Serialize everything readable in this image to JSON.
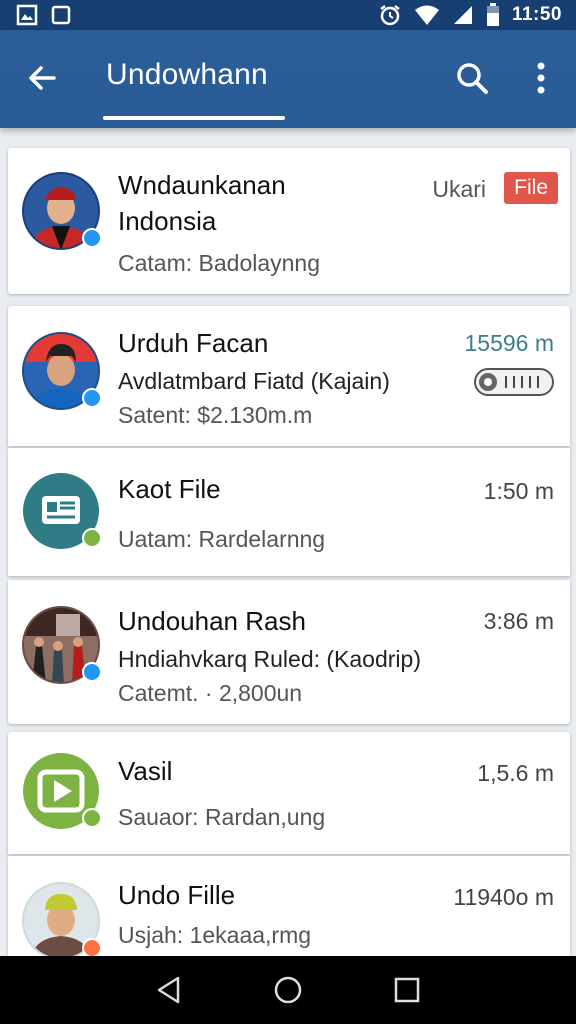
{
  "status_bar": {
    "time": "11:50",
    "icons": [
      "gallery-icon",
      "square-icon",
      "alarm-icon",
      "wifi-icon",
      "signal-icon",
      "battery-icon"
    ]
  },
  "app_bar": {
    "title": "Undowhann",
    "back_icon": "arrow-left-icon",
    "search_icon": "search-icon",
    "menu_icon": "more-vert-icon",
    "color": "#2a5c96"
  },
  "items": [
    {
      "title_line1": "Wndaunkanan",
      "title_line2": "Indonsia",
      "meta": "Catam: Badolaynng",
      "right": "Ukari",
      "tag": "File",
      "tag_color": "#e0574a"
    },
    {
      "title": "Urduh Facan",
      "subtitle": "Avdlatmbard Fiatd (Kajain)",
      "meta": "Satent: $2.130m.m",
      "right": "15596 m"
    },
    {
      "title": "Kaot File",
      "meta": "Uatam: Rardelarnng",
      "right": "1:50 m"
    },
    {
      "title": "Undouhan Rash",
      "subtitle": "Hndiahvkarq Ruled: (Kaodrip)",
      "meta": "Catemt. · 2,800un",
      "right": "3:86 m"
    },
    {
      "title": "Vasil",
      "meta": "Sauaor: Rardan,ung",
      "right": "1,5.6 m"
    },
    {
      "title": "Undo Fille",
      "meta": "Usjah: 1ekaaa,rmg",
      "right": "11940o m"
    }
  ],
  "nav_bar": {
    "icons": [
      "back-triangle-icon",
      "home-circle-icon",
      "recents-square-icon"
    ]
  }
}
